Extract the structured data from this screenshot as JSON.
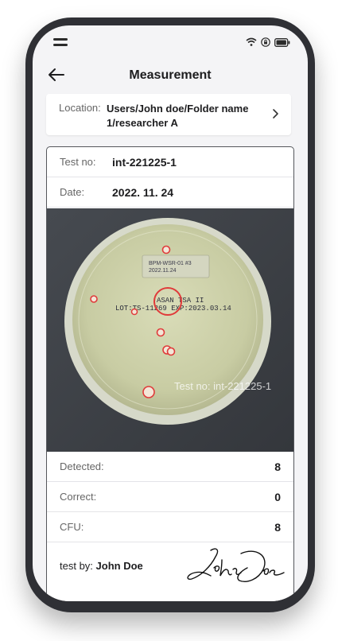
{
  "app": {
    "title": "Measurement"
  },
  "location": {
    "label": "Location:",
    "value": "Users/John doe/Folder name 1/researcher A"
  },
  "test": {
    "test_no_label": "Test no:",
    "test_no": "int-221225-1",
    "date_label": "Date:",
    "date": "2022. 11. 24"
  },
  "image": {
    "plate_label_line1": "BPM-WSR-01 #3",
    "plate_label_line2": "2022.11.24",
    "plate_print_line1": "ASAN TSA II",
    "plate_print_line2": "LOT:TS-11269 EXP:2023.03.14",
    "overlay_text": "Test no: int-221225-1"
  },
  "results": {
    "detected_label": "Detected:",
    "detected": "8",
    "correct_label": "Correct:",
    "correct": "0",
    "cfu_label": "CFU:",
    "cfu": "8"
  },
  "signature": {
    "label": "test by:",
    "name": "John Doe",
    "signature_text": "John Doe"
  },
  "icons": {
    "menu": "menu-icon",
    "wifi": "wifi-icon",
    "lock": "lock-icon",
    "battery": "battery-icon",
    "back": "arrow-left-icon",
    "chevron": "chevron-right-icon"
  },
  "colors": {
    "detection_ring": "#e03a3a",
    "frame": "#2f3035",
    "card_border": "#55575c"
  }
}
